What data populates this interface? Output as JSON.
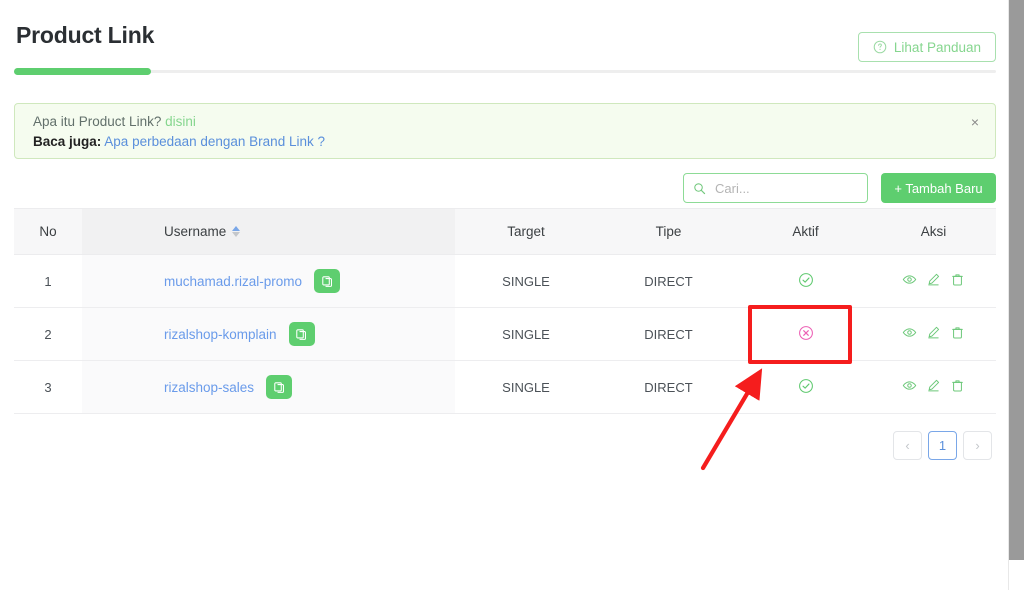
{
  "header": {
    "title": "Product Link",
    "guide_button": "Lihat Panduan",
    "guide_icon": "question-circle-icon"
  },
  "progress": {
    "percent": 14
  },
  "alert": {
    "line1_text": "Apa itu Product Link?",
    "line1_link": "disini",
    "line2_label": "Baca juga:",
    "line2_link": "Apa perbedaan dengan Brand Link ?",
    "close_label": "×"
  },
  "toolbar": {
    "search_placeholder": "Cari...",
    "search_value": "",
    "search_icon": "search-icon",
    "add_button": "+ Tambah Baru"
  },
  "table": {
    "columns": [
      {
        "key": "no",
        "label": "No",
        "sortable": false
      },
      {
        "key": "username",
        "label": "Username",
        "sortable": true
      },
      {
        "key": "target",
        "label": "Target",
        "sortable": false
      },
      {
        "key": "tipe",
        "label": "Tipe",
        "sortable": false
      },
      {
        "key": "aktif",
        "label": "Aktif",
        "sortable": false
      },
      {
        "key": "aksi",
        "label": "Aksi",
        "sortable": false
      }
    ],
    "rows": [
      {
        "no": "1",
        "username": "muchamad.rizal-promo",
        "target": "SINGLE",
        "tipe": "DIRECT",
        "aktif": "active",
        "copy_icon": "copy-icon"
      },
      {
        "no": "2",
        "username": "rizalshop-komplain",
        "target": "SINGLE",
        "tipe": "DIRECT",
        "aktif": "inactive",
        "copy_icon": "copy-icon"
      },
      {
        "no": "3",
        "username": "rizalshop-sales",
        "target": "SINGLE",
        "tipe": "DIRECT",
        "aktif": "active",
        "copy_icon": "copy-icon"
      }
    ],
    "action_icons": [
      "eye-icon",
      "pencil-icon",
      "trash-icon"
    ]
  },
  "pagination": {
    "prev": "‹",
    "next": "›",
    "pages": [
      "1"
    ],
    "current": "1"
  },
  "colors": {
    "green": "#5ece6f",
    "green_light": "#86d68f",
    "blue_link": "#6a9bea",
    "pink_inactive": "#ec5fb4",
    "annotation_red": "#f51d1d",
    "alert_bg": "#f5fcef"
  }
}
